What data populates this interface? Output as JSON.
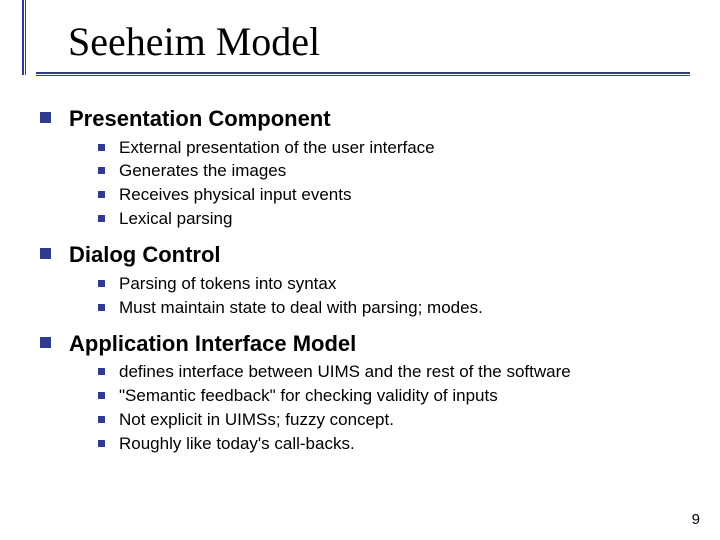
{
  "title": "Seeheim Model",
  "page_number": "9",
  "sections": [
    {
      "heading": "Presentation Component",
      "items": [
        "External presentation of the user interface",
        "Generates the images",
        "Receives physical input events",
        "Lexical parsing"
      ]
    },
    {
      "heading": "Dialog Control",
      "items": [
        "Parsing of tokens into syntax",
        "Must maintain state to deal with parsing; modes."
      ]
    },
    {
      "heading": "Application Interface Model",
      "items": [
        "defines interface between UIMS and the rest of the software",
        "\"Semantic feedback\" for checking validity of inputs",
        "Not explicit in UIMSs; fuzzy concept.",
        "Roughly like today's call-backs."
      ]
    }
  ]
}
